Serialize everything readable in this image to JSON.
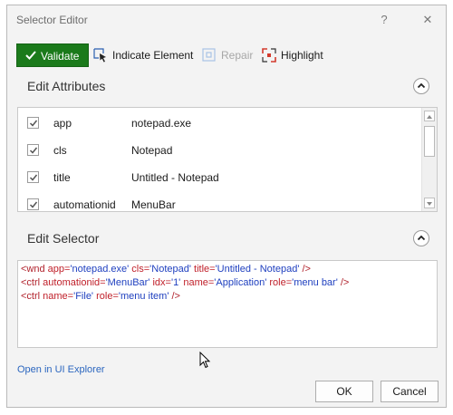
{
  "window": {
    "title": "Selector Editor",
    "help_glyph": "?",
    "close_glyph": "✕"
  },
  "toolbar": {
    "validate_label": "Validate",
    "indicate_label": "Indicate Element",
    "repair_label": "Repair",
    "highlight_label": "Highlight"
  },
  "attributes": {
    "header": "Edit Attributes",
    "rows": [
      {
        "name": "app",
        "value": "notepad.exe",
        "checked": true
      },
      {
        "name": "cls",
        "value": "Notepad",
        "checked": true
      },
      {
        "name": "title",
        "value": "Untitled - Notepad",
        "checked": true
      },
      {
        "name": "automationid",
        "value": "MenuBar",
        "checked": true
      }
    ]
  },
  "selector": {
    "header": "Edit Selector",
    "lines": [
      [
        {
          "t": "<wnd ",
          "k": "tag"
        },
        {
          "t": "app=",
          "k": "attr"
        },
        {
          "t": "'notepad.exe'",
          "k": "val"
        },
        {
          "t": " cls=",
          "k": "attr"
        },
        {
          "t": "'Notepad'",
          "k": "val"
        },
        {
          "t": " title=",
          "k": "attr"
        },
        {
          "t": "'Untitled - Notepad'",
          "k": "val"
        },
        {
          "t": " />",
          "k": "tag"
        }
      ],
      [
        {
          "t": "<ctrl ",
          "k": "tag"
        },
        {
          "t": "automationid=",
          "k": "attr"
        },
        {
          "t": "'MenuBar'",
          "k": "val"
        },
        {
          "t": " idx=",
          "k": "attr"
        },
        {
          "t": "'1'",
          "k": "val"
        },
        {
          "t": " name=",
          "k": "attr"
        },
        {
          "t": "'Application'",
          "k": "val"
        },
        {
          "t": " role=",
          "k": "attr"
        },
        {
          "t": "'menu bar'",
          "k": "val"
        },
        {
          "t": " />",
          "k": "tag"
        }
      ],
      [
        {
          "t": "<ctrl ",
          "k": "tag"
        },
        {
          "t": "name=",
          "k": "attr"
        },
        {
          "t": "'File'",
          "k": "val"
        },
        {
          "t": " role=",
          "k": "attr"
        },
        {
          "t": "'menu item'",
          "k": "val"
        },
        {
          "t": " />",
          "k": "tag"
        }
      ]
    ]
  },
  "footer": {
    "explorer_link": "Open in UI Explorer",
    "ok_label": "OK",
    "cancel_label": "Cancel"
  },
  "colors": {
    "validate_green": "#1b7a1b",
    "link_blue": "#2b66bf",
    "selector_tag": "#b1232d",
    "selector_value": "#1e3fbf"
  }
}
